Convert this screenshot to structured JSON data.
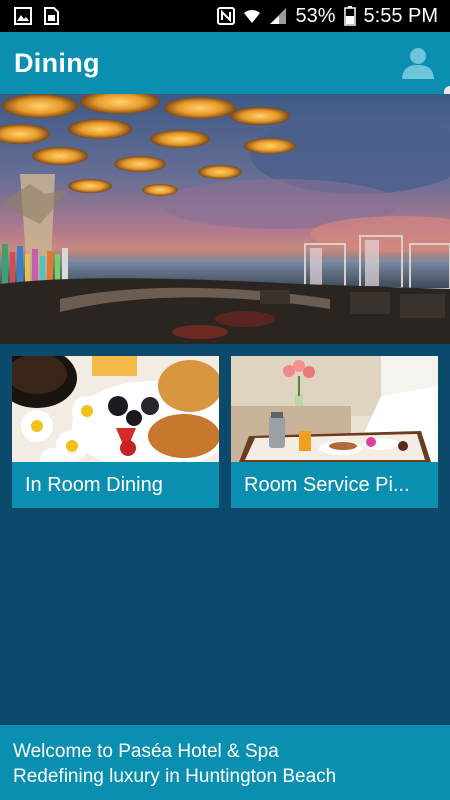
{
  "status_bar": {
    "battery_percent": "53%",
    "time": "5:55 PM",
    "icons": [
      "image-icon",
      "sim-card-icon",
      "nfc-icon",
      "wifi-icon",
      "signal-icon",
      "battery-icon"
    ]
  },
  "app_bar": {
    "title": "Dining",
    "profile_icon": "user-icon"
  },
  "tiles": [
    {
      "label": "In Room Dining"
    },
    {
      "label": "Room Service Pi..."
    }
  ],
  "footer": {
    "line1": "Welcome to Paséa Hotel & Spa",
    "line2": "Redefining luxury in Huntington Beach"
  },
  "colors": {
    "app_bar": "#0a8fb0",
    "background": "#0b4a6b",
    "status_bar": "#000000"
  }
}
